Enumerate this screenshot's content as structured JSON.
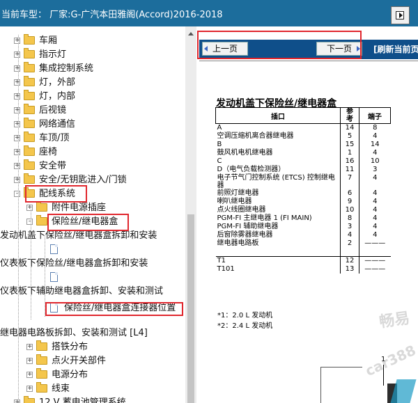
{
  "header": {
    "title": "当前车型：  厂家:G-广汽本田雅阁(Accord)2016-2018"
  },
  "tree": {
    "items": [
      {
        "label": "车厢",
        "type": "folder"
      },
      {
        "label": "指示灯",
        "type": "folder"
      },
      {
        "label": "集成控制系统",
        "type": "folder"
      },
      {
        "label": "灯，外部",
        "type": "folder"
      },
      {
        "label": "灯，内部",
        "type": "folder"
      },
      {
        "label": "后视镜",
        "type": "folder"
      },
      {
        "label": "网络通信",
        "type": "folder"
      },
      {
        "label": "车顶/顶",
        "type": "folder"
      },
      {
        "label": "座椅",
        "type": "folder"
      },
      {
        "label": "安全带",
        "type": "folder"
      },
      {
        "label": "安全/无钥匙进入/门锁",
        "type": "folder"
      },
      {
        "label": "配线系统",
        "type": "folder"
      },
      {
        "label": "附件电源插座",
        "type": "folder"
      },
      {
        "label": "保险丝/继电器盒",
        "type": "folder"
      },
      {
        "label": "发动机盖下保险丝/继电器盒拆卸和安装",
        "type": "section"
      },
      {
        "label": "仪表板下保险丝/继电器盒拆卸和安装",
        "type": "section"
      },
      {
        "label": "仪表板下辅助继电器盒拆卸、安装和测试",
        "type": "section"
      },
      {
        "label": "保险丝/继电器盒连接器位置",
        "type": "doc"
      },
      {
        "label": "继电器电路板拆卸、安装和测试 [L4]",
        "type": "section"
      },
      {
        "label": "搭铁分布",
        "type": "folder"
      },
      {
        "label": "点火开关部件",
        "type": "folder"
      },
      {
        "label": "电源分布",
        "type": "folder"
      },
      {
        "label": "线束",
        "type": "folder"
      },
      {
        "label": "12 V 蓄电池管理系统",
        "type": "folder"
      }
    ]
  },
  "nav": {
    "prev_label": "上一页",
    "next_label": "下一页",
    "refresh_label": "[刷新当前页"
  },
  "document": {
    "title": "发动机盖下保险丝/继电器盒",
    "headers": [
      "插口",
      "参考",
      "端子"
    ],
    "rows": [
      {
        "name": "A",
        "ref": "14",
        "term": "8"
      },
      {
        "name": "空调压缩机离合器继电器",
        "ref": "5",
        "term": "4"
      },
      {
        "name": "B",
        "ref": "15",
        "term": "14"
      },
      {
        "name": "鼓风机电机继电器",
        "ref": "1",
        "term": "4"
      },
      {
        "name": "C",
        "ref": "16",
        "term": "10"
      },
      {
        "name": "D（电气负载检测器）",
        "ref": "11",
        "term": "3"
      },
      {
        "name": "电子节气门控制系统 (ETCS) 控制继电器",
        "ref": "7",
        "term": "4"
      },
      {
        "name": "前照灯继电器",
        "ref": "6",
        "term": "4"
      },
      {
        "name": "喇叭继电器",
        "ref": "9",
        "term": "4"
      },
      {
        "name": "点火线圈继电器",
        "ref": "10",
        "term": "4"
      },
      {
        "name": "PGM-FI 主继电器 1 (FI MAIN)",
        "ref": "8",
        "term": "4"
      },
      {
        "name": "PGM-FI 辅助继电器",
        "ref": "3",
        "term": "4"
      },
      {
        "name": "后窗除雾器继电器",
        "ref": "4",
        "term": "4"
      },
      {
        "name": "继电器电路板",
        "ref": "2",
        "term": "———"
      },
      {
        "name": "T1",
        "ref": "12",
        "term": "———"
      },
      {
        "name": "T101",
        "ref": "13",
        "term": "———"
      }
    ],
    "notes": [
      "*1：2.0 L 发动机",
      "*2：2.4 L 发动机"
    ],
    "callout": "1"
  },
  "watermark": [
    "畅易",
    "car388"
  ]
}
